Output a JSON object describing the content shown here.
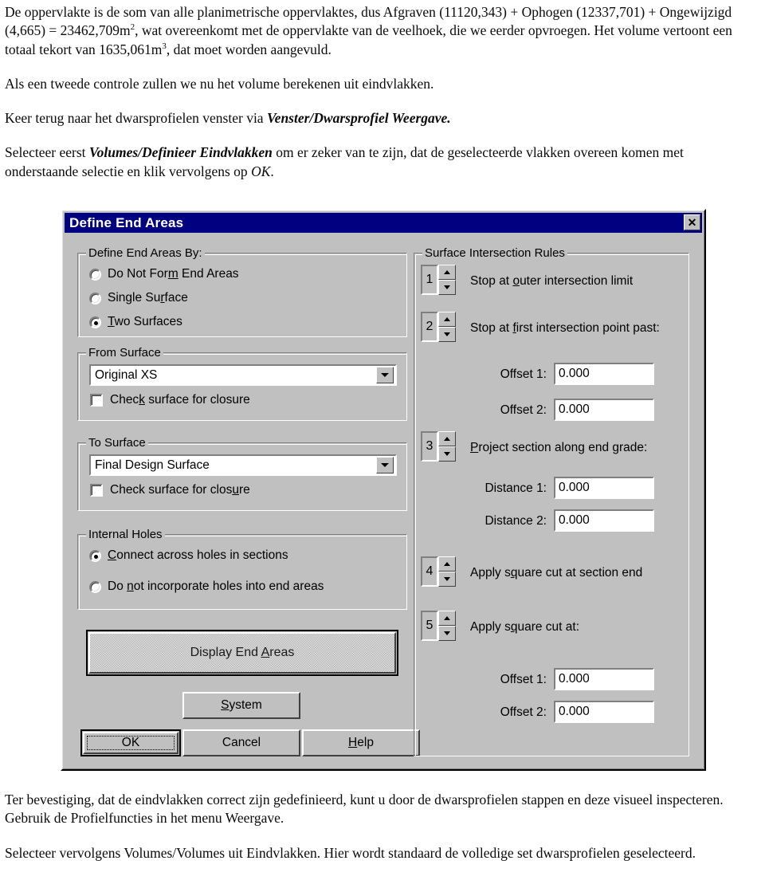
{
  "document": {
    "top_paragraphs": [
      "De oppervlakte is de som van alle planimetrische oppervlaktes, dus Afgraven (11120,343) + Ophogen (12337,701) + Ongewijzigd (4,665) = 23462,709m², wat overeenkomt met de oppervlakte van de veelhoek, die we eerder opvroegen.  Het volume vertoont een totaal tekort van 1635,061m³, dat moet worden aangevuld.",
      "Als een tweede controle zullen we nu het volume berekenen uit eindvlakken.",
      "Keer terug naar het dwarsprofielen venster via Venster/Dwarsprofiel Weergave.",
      "Selecteer eerst Volumes/Definieer Eindvlakken om er zeker van te zijn, dat de geselecteerde vlakken overeen komen met onderstaande selectie en klik vervolgens op OK."
    ],
    "p1_a": "De oppervlakte is de som van alle planimetrische oppervlaktes, dus Afgraven (11120,343) + Ophogen (12337,701) + Ongewijzigd (4,665) = 23462,709m",
    "p1_sup1": "2",
    "p1_b": ", wat overeenkomt met de oppervlakte van de veelhoek, die we eerder opvroegen.  Het volume vertoont een totaal tekort van 1635,061m",
    "p1_sup2": "3",
    "p1_c": ", dat moet worden aangevuld.",
    "p2": "Als een tweede controle zullen we nu het volume berekenen uit eindvlakken.",
    "p3_a": "Keer terug naar het dwarsprofielen venster via ",
    "p3_em": "Venster/Dwarsprofiel Weergave.",
    "p4_a": "Selecteer eerst ",
    "p4_em": "Volumes/Definieer Eindvlakken",
    "p4_b": " om er zeker van te zijn, dat de geselecteerde vlakken overeen komen met onderstaande selectie en klik vervolgens op ",
    "p4_em2": "OK",
    "p4_c": ".",
    "p5_a": "Ter bevestiging, dat de eindvlakken correct zijn gedefinieerd, kunt u door de dwarsprofielen stappen en deze visueel inspecteren. Gebruik de Profielfuncties in het menu ",
    "p5_em": "Weergave.",
    "p6_a": "Selecteer vervolgens ",
    "p6_em": "Volumes/Volumes uit Eindvlakken.",
    "p6_b": "  Hier wordt standaard de volledige set dwarsprofielen geselecteerd."
  },
  "dialog": {
    "title": "Define End Areas",
    "close_label": "✕",
    "colors": {
      "titlebar": "#000080",
      "face": "#c0c0c0",
      "field": "#ffffff"
    },
    "define_group": {
      "title": "Define End Areas By:",
      "options": [
        {
          "label": "Do Not Form End Areas",
          "selected": false
        },
        {
          "label": "Single Surface",
          "selected": false
        },
        {
          "label": "Two Surfaces",
          "selected": true
        }
      ]
    },
    "from_surface": {
      "title": "From Surface",
      "value": "Original XS",
      "checkbox_label": "Check surface for closure",
      "checked": false
    },
    "to_surface": {
      "title": "To Surface",
      "value": "Final Design Surface",
      "checkbox_label": "Check surface for closure",
      "checked": false
    },
    "internal_holes": {
      "title": "Internal Holes",
      "options": [
        {
          "label": "Connect across holes in sections",
          "selected": true
        },
        {
          "label": "Do not incorporate holes into end areas",
          "selected": false
        }
      ]
    },
    "display_button": "Display End Areas",
    "buttons": {
      "system": "System",
      "ok": "OK",
      "cancel": "Cancel",
      "help": "Help"
    },
    "rules_group": {
      "title": "Surface Intersection Rules",
      "rules": [
        {
          "number": "1",
          "label": "Stop at outer intersection limit"
        },
        {
          "number": "2",
          "label": "Stop at first intersection point past:"
        },
        {
          "number": "3",
          "label": "Project section along end grade:"
        },
        {
          "number": "4",
          "label": "Apply square cut at section end"
        },
        {
          "number": "5",
          "label": "Apply square cut at:"
        }
      ],
      "fields": [
        {
          "label": "Offset 1:",
          "value": "0.000"
        },
        {
          "label": "Offset 2:",
          "value": "0.000"
        },
        {
          "label": "Distance 1:",
          "value": "0.000"
        },
        {
          "label": "Distance 2:",
          "value": "0.000"
        },
        {
          "label": "Offset 1:",
          "value": "0.000"
        },
        {
          "label": "Offset 2:",
          "value": "0.000"
        }
      ]
    }
  }
}
